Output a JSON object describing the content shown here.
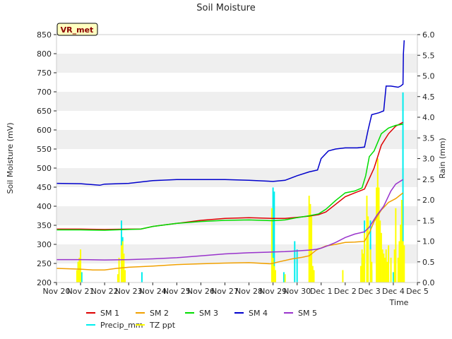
{
  "chart_data": {
    "type": "line",
    "title": "Soil Moisture",
    "badge": "VR_met",
    "xlabel": "Time",
    "ylabel": "Soil Moisture (mV)",
    "ylabel_right": "Rain (mm)",
    "xlim": [
      0,
      15
    ],
    "ylim": [
      200,
      850
    ],
    "ylim_right": [
      0,
      6.0
    ],
    "x_ticks": [
      {
        "x": 0,
        "label": "Nov 20"
      },
      {
        "x": 1,
        "label": "Nov 21"
      },
      {
        "x": 2,
        "label": "Nov 22"
      },
      {
        "x": 3,
        "label": "Nov 23"
      },
      {
        "x": 4,
        "label": "Nov 24"
      },
      {
        "x": 5,
        "label": "Nov 25"
      },
      {
        "x": 6,
        "label": "Nov 26"
      },
      {
        "x": 7,
        "label": "Nov 27"
      },
      {
        "x": 8,
        "label": "Nov 28"
      },
      {
        "x": 9,
        "label": "Nov 29"
      },
      {
        "x": 10,
        "label": "Nov 30"
      },
      {
        "x": 11,
        "label": "Dec 1"
      },
      {
        "x": 12,
        "label": "Dec 2"
      },
      {
        "x": 13,
        "label": "Dec 3"
      },
      {
        "x": 14,
        "label": "Dec 4"
      },
      {
        "x": 15,
        "label": "Dec 5"
      }
    ],
    "y_ticks": [
      200,
      250,
      300,
      350,
      400,
      450,
      500,
      550,
      600,
      650,
      700,
      750,
      800,
      850
    ],
    "y_ticks_right": [
      "0.0",
      "0.5",
      "1.0",
      "1.5",
      "2.0",
      "2.5",
      "3.0",
      "3.5",
      "4.0",
      "4.5",
      "5.0",
      "5.5",
      "6.0"
    ],
    "legend_position": "bottom",
    "series": [
      {
        "name": "SM 1",
        "color": "#dd0000",
        "axis": "left",
        "x": [
          0,
          1,
          2,
          3,
          3.5,
          4,
          5,
          6,
          7,
          8,
          9,
          9.5,
          10,
          10.5,
          10.9,
          11.2,
          11.6,
          12,
          12.4,
          12.8,
          13.2,
          13.5,
          13.8,
          14.1,
          14.4
        ],
        "y": [
          340,
          340,
          339,
          340,
          340,
          347,
          355,
          363,
          368,
          370,
          368,
          368,
          371,
          374,
          378,
          385,
          405,
          425,
          435,
          445,
          500,
          560,
          590,
          610,
          620
        ]
      },
      {
        "name": "SM 2",
        "color": "#f0a000",
        "axis": "left",
        "x": [
          0,
          1,
          1.5,
          2,
          2.5,
          3,
          4,
          5,
          6,
          7,
          8,
          8.9,
          9.3,
          9.8,
          10.2,
          10.5,
          10.8,
          11.2,
          11.6,
          12,
          12.4,
          12.8,
          13,
          13.2,
          13.5,
          13.8,
          14.1,
          14.4
        ],
        "y": [
          237,
          235,
          233,
          233,
          237,
          240,
          243,
          247,
          249,
          251,
          252,
          249,
          255,
          262,
          266,
          270,
          285,
          296,
          300,
          305,
          306,
          308,
          330,
          360,
          390,
          410,
          420,
          435
        ]
      },
      {
        "name": "SM 3",
        "color": "#00dd00",
        "axis": "left",
        "x": [
          0,
          1,
          2,
          3,
          3.5,
          4,
          5,
          6,
          7,
          8,
          9,
          9.5,
          10,
          10.5,
          10.9,
          11.2,
          11.6,
          12,
          12.4,
          12.7,
          12.85,
          13,
          13.2,
          13.5,
          13.8,
          14.1,
          14.4
        ],
        "y": [
          338,
          338,
          337,
          339,
          340,
          347,
          355,
          360,
          363,
          364,
          362,
          364,
          370,
          375,
          380,
          392,
          415,
          435,
          440,
          448,
          480,
          530,
          545,
          590,
          605,
          612,
          615
        ]
      },
      {
        "name": "SM 4",
        "color": "#0000cc",
        "axis": "left",
        "x": [
          0,
          1,
          1.8,
          2,
          3,
          4,
          5,
          6,
          7,
          8,
          9,
          9.5,
          10,
          10.5,
          10.85,
          11,
          11.3,
          11.6,
          12,
          12.5,
          12.8,
          12.95,
          13.1,
          13.4,
          13.6,
          13.7,
          13.9,
          14.2,
          14.3,
          14.4,
          14.42,
          14.45
        ],
        "y": [
          460,
          459,
          455,
          458,
          460,
          467,
          470,
          470,
          470,
          468,
          465,
          468,
          480,
          490,
          495,
          525,
          545,
          550,
          553,
          553,
          555,
          600,
          640,
          645,
          650,
          715,
          715,
          712,
          715,
          720,
          800,
          835
        ]
      },
      {
        "name": "SM 5",
        "color": "#9933cc",
        "axis": "left",
        "x": [
          0,
          1,
          2,
          3,
          4,
          5,
          6,
          7,
          8,
          9,
          9.5,
          10,
          10.5,
          10.8,
          11,
          11.3,
          11.6,
          12,
          12.4,
          12.8,
          13,
          13.3,
          13.6,
          13.9,
          14.1,
          14.4
        ],
        "y": [
          260,
          260,
          259,
          260,
          262,
          265,
          270,
          275,
          278,
          280,
          281,
          283,
          285,
          287,
          290,
          297,
          305,
          318,
          327,
          333,
          345,
          375,
          400,
          440,
          458,
          470
        ]
      },
      {
        "name": "Precip_mm",
        "color": "#00eeee",
        "axis": "right",
        "kind": "bars",
        "x": [
          0.9,
          1.05,
          2.7,
          2.75,
          3.55,
          9.0,
          9.05,
          9.45,
          9.9,
          10.0,
          12.7,
          12.8,
          13.05,
          13.1,
          14.0,
          14.3,
          14.4
        ],
        "y": [
          0.5,
          0.25,
          1.5,
          1.1,
          0.25,
          2.3,
          2.2,
          0.25,
          1.0,
          0.8,
          0.6,
          1.5,
          1.5,
          0.3,
          0.25,
          0.5,
          4.6
        ]
      },
      {
        "name": "TZ ppt",
        "color": "#ffff00",
        "axis": "right",
        "kind": "bars",
        "x": [
          0.85,
          0.9,
          0.95,
          1.0,
          2.55,
          2.6,
          2.7,
          2.75,
          2.8,
          2.85,
          8.95,
          9.0,
          9.05,
          9.1,
          9.5,
          10.5,
          10.55,
          10.6,
          10.65,
          10.7,
          11.9,
          12.65,
          12.7,
          12.75,
          12.8,
          12.9,
          12.95,
          13.05,
          13.1,
          13.3,
          13.35,
          13.4,
          13.45,
          13.5,
          13.55,
          13.6,
          13.65,
          13.7,
          13.75,
          13.8,
          13.9,
          14.05,
          14.1,
          14.2,
          14.25,
          14.3,
          14.35,
          14.4,
          14.45
        ],
        "y": [
          0.3,
          0.5,
          0.6,
          0.8,
          0.2,
          0.6,
          0.9,
          1.0,
          0.7,
          0.3,
          1.8,
          0.6,
          0.4,
          0.3,
          0.2,
          2.1,
          1.9,
          1.6,
          0.4,
          0.3,
          0.3,
          0.4,
          0.8,
          0.7,
          1.2,
          2.1,
          1.6,
          0.8,
          0.5,
          2.3,
          3.0,
          2.3,
          1.5,
          1.2,
          0.8,
          0.7,
          0.6,
          0.8,
          0.5,
          0.9,
          0.6,
          0.8,
          1.8,
          0.6,
          1.0,
          1.4,
          2.0,
          1.0,
          0.9
        ]
      }
    ]
  }
}
